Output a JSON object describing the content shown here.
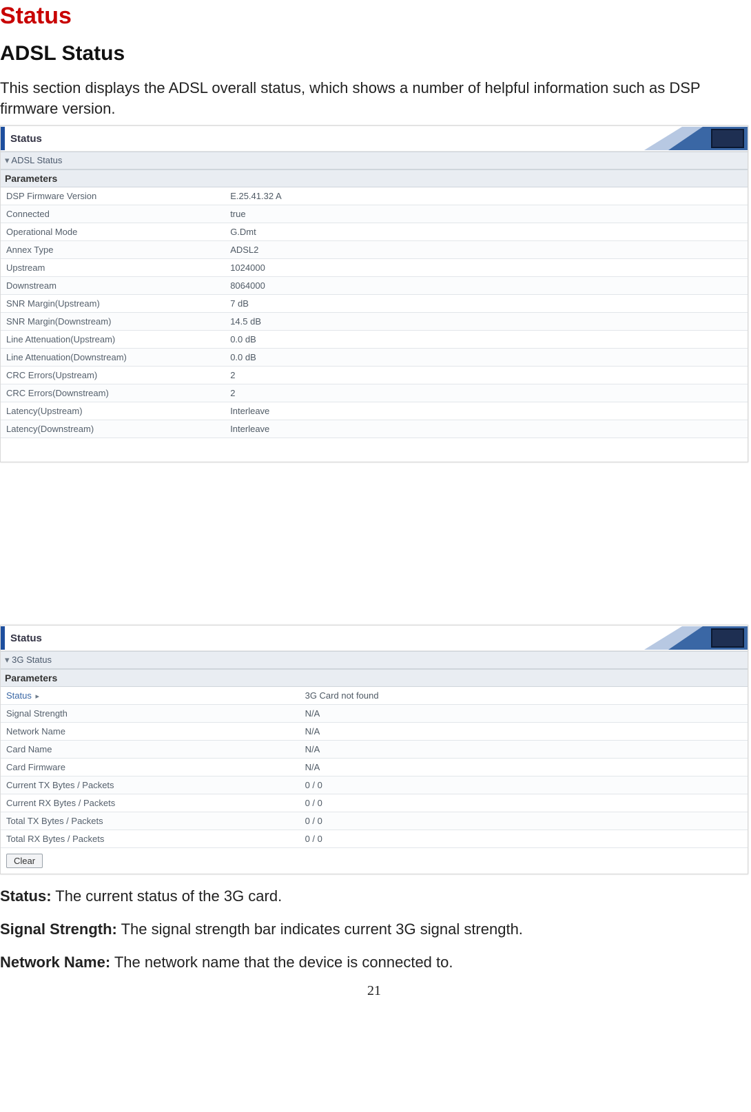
{
  "doc": {
    "title_red": "Status",
    "title_black": "ADSL Status",
    "intro": "This section displays the ADSL overall status, which shows a number of helpful information such as DSP firmware version.",
    "page_number": "21",
    "desc_status_label": "Status:",
    "desc_status_text": " The current status of the 3G card.",
    "desc_signal_label": "Signal Strength:",
    "desc_signal_text": " The signal strength bar indicates current 3G signal strength.",
    "desc_network_label": "Network Name:",
    "desc_network_text": " The network name that the device is connected to."
  },
  "adsl": {
    "tab": "Status",
    "section": "ADSL Status",
    "param_header": "Parameters",
    "rows": [
      {
        "k": "DSP Firmware Version",
        "v": "E.25.41.32 A"
      },
      {
        "k": "Connected",
        "v": "true"
      },
      {
        "k": "Operational Mode",
        "v": "G.Dmt"
      },
      {
        "k": "Annex Type",
        "v": "ADSL2"
      },
      {
        "k": "Upstream",
        "v": "1024000"
      },
      {
        "k": "Downstream",
        "v": "8064000"
      },
      {
        "k": "SNR Margin(Upstream)",
        "v": "7 dB"
      },
      {
        "k": "SNR Margin(Downstream)",
        "v": "14.5 dB"
      },
      {
        "k": "Line Attenuation(Upstream)",
        "v": "0.0 dB"
      },
      {
        "k": "Line Attenuation(Downstream)",
        "v": "0.0 dB"
      },
      {
        "k": "CRC Errors(Upstream)",
        "v": "2"
      },
      {
        "k": "CRC Errors(Downstream)",
        "v": "2"
      },
      {
        "k": "Latency(Upstream)",
        "v": "Interleave"
      },
      {
        "k": "Latency(Downstream)",
        "v": "Interleave"
      }
    ]
  },
  "g3": {
    "tab": "Status",
    "section": "3G Status",
    "param_header": "Parameters",
    "status_row_label": "Status",
    "status_row_value": "3G Card not found",
    "rows": [
      {
        "k": "Signal Strength",
        "v": "N/A"
      },
      {
        "k": "Network Name",
        "v": "N/A"
      },
      {
        "k": "Card Name",
        "v": "N/A"
      },
      {
        "k": "Card Firmware",
        "v": "N/A"
      },
      {
        "k": "Current TX Bytes / Packets",
        "v": "0 /  0"
      },
      {
        "k": "Current RX Bytes / Packets",
        "v": "0 /  0"
      },
      {
        "k": "Total TX Bytes / Packets",
        "v": "0 /  0"
      },
      {
        "k": "Total RX Bytes / Packets",
        "v": "0 /  0"
      }
    ],
    "clear_btn": "Clear"
  }
}
